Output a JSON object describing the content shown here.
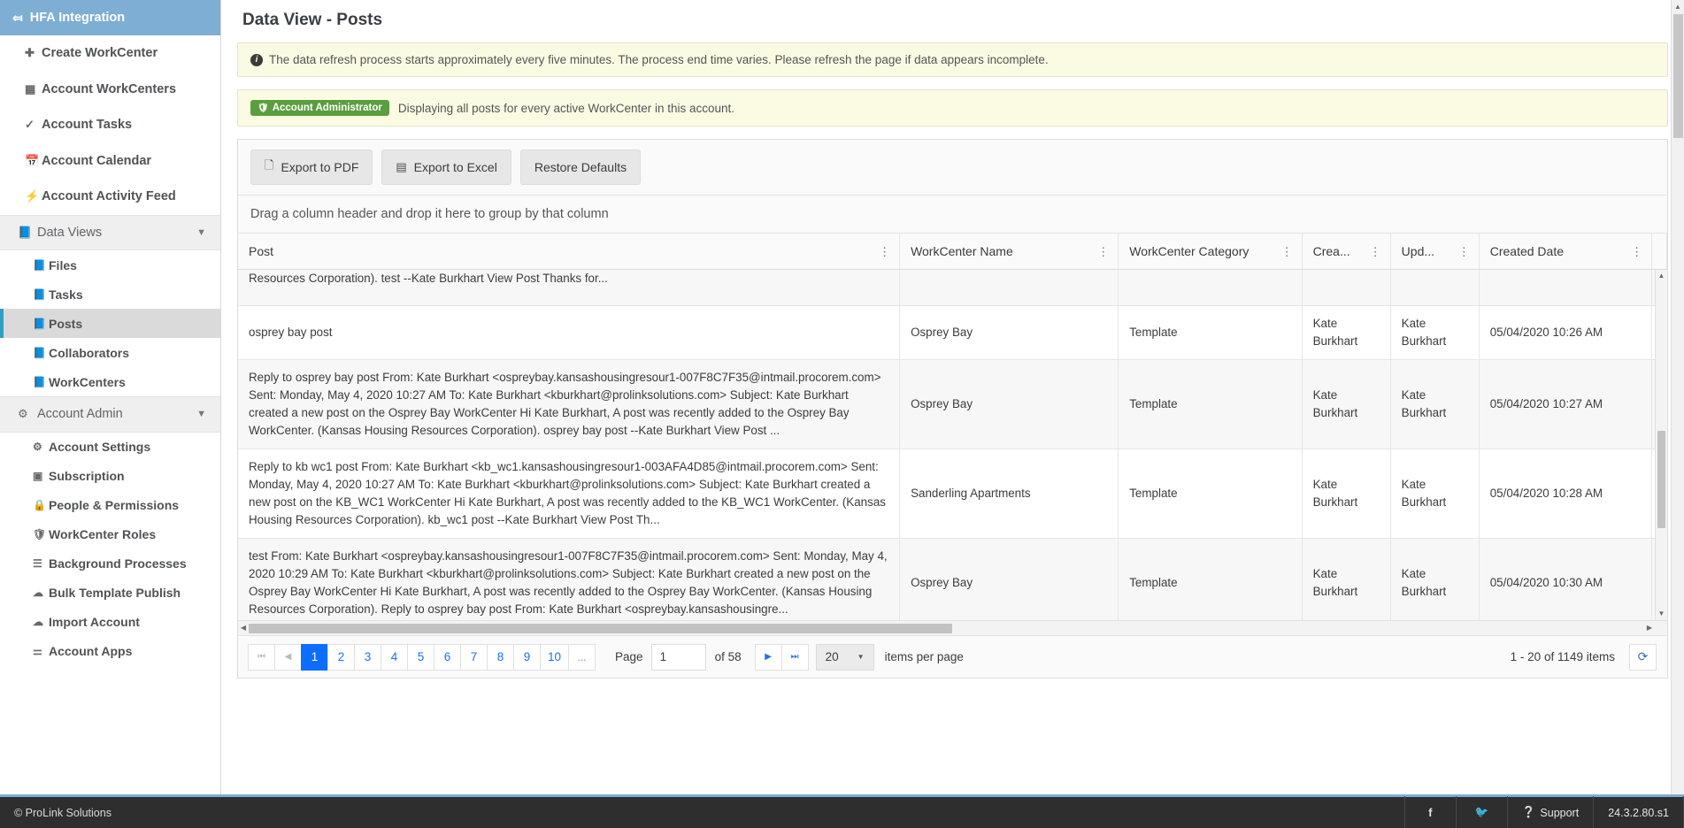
{
  "sidebar": {
    "header": {
      "label": "HFA Integration",
      "back_icon": "arrow-left-icon"
    },
    "items": [
      {
        "label": "Create WorkCenter",
        "icon": "plus-icon",
        "name": "create-workcenter"
      },
      {
        "label": "Account WorkCenters",
        "icon": "grid-icon",
        "name": "account-workcenters"
      },
      {
        "label": "Account Tasks",
        "icon": "check-icon",
        "name": "account-tasks"
      },
      {
        "label": "Account Calendar",
        "icon": "calendar-icon",
        "name": "account-calendar"
      },
      {
        "label": "Account Activity Feed",
        "icon": "bolt-icon",
        "name": "account-activity-feed"
      }
    ],
    "groups": [
      {
        "label": "Data Views",
        "icon": "book-icon",
        "caret": "chevron-down-icon",
        "name": "data-views",
        "children": [
          {
            "label": "Files",
            "icon": "book-icon",
            "name": "files",
            "active": false
          },
          {
            "label": "Tasks",
            "icon": "book-icon",
            "name": "tasks",
            "active": false
          },
          {
            "label": "Posts",
            "icon": "book-icon",
            "name": "posts",
            "active": true
          },
          {
            "label": "Collaborators",
            "icon": "book-icon",
            "name": "collaborators",
            "active": false
          },
          {
            "label": "WorkCenters",
            "icon": "book-icon",
            "name": "workcenters",
            "active": false
          }
        ]
      },
      {
        "label": "Account Admin",
        "icon": "gears-icon",
        "caret": "chevron-down-icon",
        "name": "account-admin",
        "children": [
          {
            "label": "Account Settings",
            "icon": "gear-icon",
            "name": "account-settings",
            "active": false
          },
          {
            "label": "Subscription",
            "icon": "money-icon",
            "name": "subscription",
            "active": false
          },
          {
            "label": "People & Permissions",
            "icon": "lock-icon",
            "name": "people-permissions",
            "active": false
          },
          {
            "label": "WorkCenter Roles",
            "icon": "shield-icon",
            "name": "workcenter-roles",
            "active": false
          },
          {
            "label": "Background Processes",
            "icon": "server-icon",
            "name": "background-processes",
            "active": false
          },
          {
            "label": "Bulk Template Publish",
            "icon": "cloud-upload-icon",
            "name": "bulk-template-publish",
            "active": false
          },
          {
            "label": "Import Account",
            "icon": "cloud-download-icon",
            "name": "import-account",
            "active": false
          },
          {
            "label": "Account Apps",
            "icon": "flask-icon",
            "name": "account-apps",
            "active": false
          }
        ]
      }
    ]
  },
  "page": {
    "title": "Data View - Posts",
    "info_alert": "The data refresh process starts approximately every five minutes. The process end time varies. Please refresh the page if data appears incomplete.",
    "role_badge": "Account Administrator",
    "role_message": "Displaying all posts for every active WorkCenter in this account."
  },
  "toolbar": {
    "export_pdf": "Export to PDF",
    "export_excel": "Export to Excel",
    "restore_defaults": "Restore Defaults",
    "group_hint": "Drag a column header and drop it here to group by that column"
  },
  "table": {
    "columns": [
      {
        "label": "Post",
        "name": "post"
      },
      {
        "label": "WorkCenter Name",
        "name": "workcenter-name"
      },
      {
        "label": "WorkCenter Category",
        "name": "workcenter-category"
      },
      {
        "label": "Crea...",
        "name": "created-by"
      },
      {
        "label": "Upd...",
        "name": "updated-by"
      },
      {
        "label": "Created Date",
        "name": "created-date"
      }
    ],
    "clipped_row_text": "Resources Corporation). test --Kate Burkhart View Post Thanks for...",
    "rows": [
      {
        "post": "osprey bay post",
        "workcenter_name": "Osprey Bay",
        "workcenter_category": "Template",
        "created_by": "Kate Burkhart",
        "updated_by": "Kate Burkhart",
        "created_date": "05/04/2020 10:26 AM"
      },
      {
        "post": "Reply to osprey bay post From: Kate Burkhart <ospreybay.kansashousingresour1-007F8C7F35@intmail.procorem.com> Sent: Monday, May 4, 2020 10:27 AM To: Kate Burkhart <kburkhart@prolinksolutions.com> Subject: Kate Burkhart created a new post on the Osprey Bay WorkCenter Hi Kate Burkhart, A post was recently added to the Osprey Bay WorkCenter. (Kansas Housing Resources Corporation). osprey bay post --Kate Burkhart View Post ...",
        "workcenter_name": "Osprey Bay",
        "workcenter_category": "Template",
        "created_by": "Kate Burkhart",
        "updated_by": "Kate Burkhart",
        "created_date": "05/04/2020 10:27 AM"
      },
      {
        "post": "Reply to kb wc1 post From: Kate Burkhart <kb_wc1.kansashousingresour1-003AFA4D85@intmail.procorem.com> Sent: Monday, May 4, 2020 10:27 AM To: Kate Burkhart <kburkhart@prolinksolutions.com> Subject: Kate Burkhart created a new post on the KB_WC1 WorkCenter Hi Kate Burkhart, A post was recently added to the KB_WC1 WorkCenter. (Kansas Housing Resources Corporation). kb_wc1 post --Kate Burkhart View Post Th...",
        "workcenter_name": "Sanderling Apartments",
        "workcenter_category": "Template",
        "created_by": "Kate Burkhart",
        "updated_by": "Kate Burkhart",
        "created_date": "05/04/2020 10:28 AM"
      },
      {
        "post": "test From: Kate Burkhart <ospreybay.kansashousingresour1-007F8C7F35@intmail.procorem.com> Sent: Monday, May 4, 2020 10:29 AM To: Kate Burkhart <kburkhart@prolinksolutions.com> Subject: Kate Burkhart created a new post on the Osprey Bay WorkCenter Hi Kate Burkhart, A post was recently added to the Osprey Bay WorkCenter. (Kansas Housing Resources Corporation). Reply to osprey bay post From: Kate Burkhart <ospreybay.kansashousingre...",
        "workcenter_name": "Osprey Bay",
        "workcenter_category": "Template",
        "created_by": "Kate Burkhart",
        "updated_by": "Kate Burkhart",
        "created_date": "05/04/2020 10:30 AM"
      }
    ]
  },
  "pager": {
    "first_icon": "first-page-icon",
    "prev_icon": "prev-page-icon",
    "next_icon": "next-page-icon",
    "last_icon": "last-page-icon",
    "pages": [
      "1",
      "2",
      "3",
      "4",
      "5",
      "6",
      "7",
      "8",
      "9",
      "10"
    ],
    "ellipsis": "...",
    "active_page": "1",
    "page_label": "Page",
    "page_value": "1",
    "of_label": "of 58",
    "per_page_value": "20",
    "per_page_label": "items per page",
    "item_range": "1 - 20 of 1149 items",
    "refresh_icon": "refresh-icon"
  },
  "footer": {
    "copyright": "© ProLink Solutions",
    "facebook_icon": "facebook-icon",
    "twitter_icon": "twitter-icon",
    "support": "Support",
    "version": "24.3.2.80.s1"
  },
  "colors": {
    "sidebar_header": "#7eaed4",
    "accent_active": "#2f9fc4",
    "badge_green": "#5a9e3f",
    "pager_active": "#0d6efd",
    "alert_bg": "#fbfbe4",
    "footer_bg": "#2e2e2e"
  }
}
